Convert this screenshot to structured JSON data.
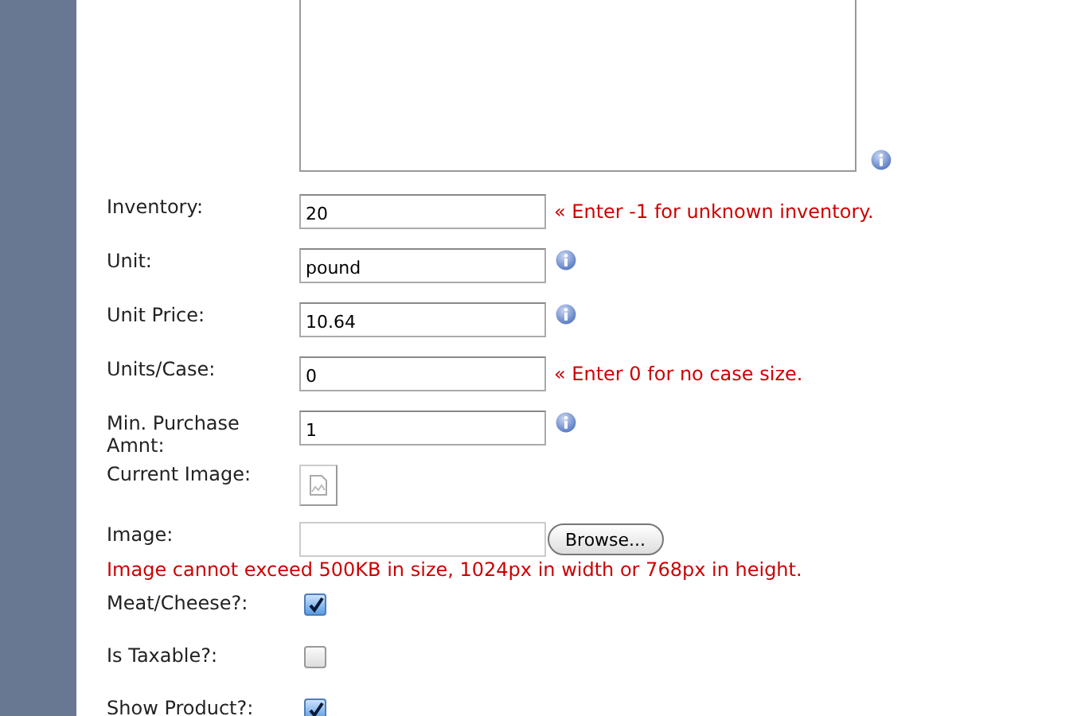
{
  "description": {
    "info": true
  },
  "fields": [
    {
      "kind": "text",
      "label": "Inventory:",
      "value": "20",
      "note": "« Enter -1 for unknown inventory."
    },
    {
      "kind": "text",
      "label": "Unit:",
      "value": "pound",
      "info": true
    },
    {
      "kind": "text",
      "label": "Unit Price:",
      "value": "10.64",
      "info": true
    },
    {
      "kind": "text",
      "label": "Units/Case:",
      "value": "0",
      "note": "« Enter 0 for no case size."
    },
    {
      "kind": "text",
      "label": "Min. Purchase Amnt:",
      "value": "1",
      "info": true
    },
    {
      "kind": "image",
      "label": "Current Image:"
    },
    {
      "kind": "file",
      "label": "Image:",
      "button": "Browse...",
      "note": "Image cannot exceed 500KB in size, 1024px in width or 768px in height."
    },
    {
      "kind": "checkbox",
      "label": "Meat/Cheese?:",
      "checked": true
    },
    {
      "kind": "checkbox",
      "label": "Is Taxable?:",
      "checked": false
    },
    {
      "kind": "checkbox",
      "label": "Show Product?:",
      "checked": true
    }
  ]
}
